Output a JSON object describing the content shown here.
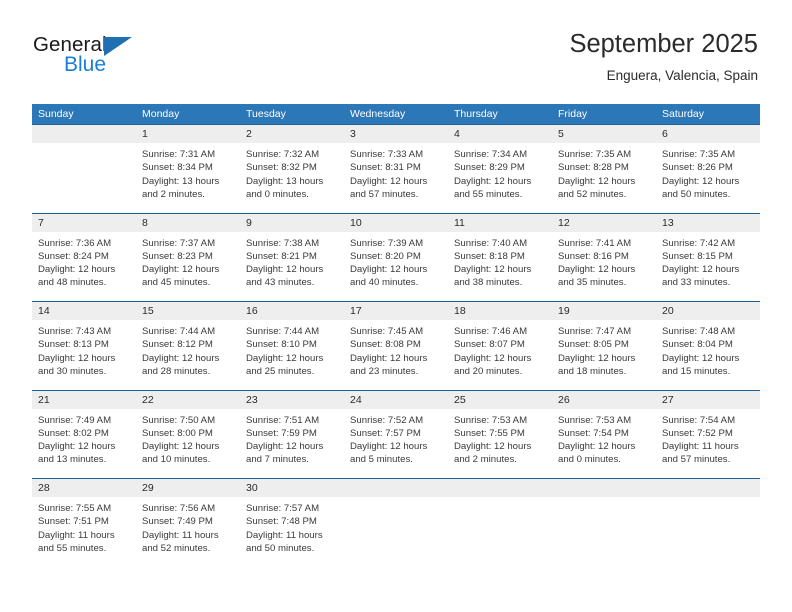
{
  "brand": {
    "name_top": "General",
    "name_bottom": "Blue",
    "accent_color": "#1a7fd4",
    "triangle_color": "#1f6fb2"
  },
  "header": {
    "title": "September 2025",
    "subtitle": "Enguera, Valencia, Spain"
  },
  "calendar": {
    "header_bg": "#2c77b8",
    "header_text_color": "#ffffff",
    "daynum_band_bg": "#eeeeee",
    "week_separator_color": "#1f6099",
    "day_names": [
      "Sunday",
      "Monday",
      "Tuesday",
      "Wednesday",
      "Thursday",
      "Friday",
      "Saturday"
    ],
    "weeks": [
      [
        {
          "day": "",
          "lines": []
        },
        {
          "day": "1",
          "lines": [
            "Sunrise: 7:31 AM",
            "Sunset: 8:34 PM",
            "Daylight: 13 hours",
            "and 2 minutes."
          ]
        },
        {
          "day": "2",
          "lines": [
            "Sunrise: 7:32 AM",
            "Sunset: 8:32 PM",
            "Daylight: 13 hours",
            "and 0 minutes."
          ]
        },
        {
          "day": "3",
          "lines": [
            "Sunrise: 7:33 AM",
            "Sunset: 8:31 PM",
            "Daylight: 12 hours",
            "and 57 minutes."
          ]
        },
        {
          "day": "4",
          "lines": [
            "Sunrise: 7:34 AM",
            "Sunset: 8:29 PM",
            "Daylight: 12 hours",
            "and 55 minutes."
          ]
        },
        {
          "day": "5",
          "lines": [
            "Sunrise: 7:35 AM",
            "Sunset: 8:28 PM",
            "Daylight: 12 hours",
            "and 52 minutes."
          ]
        },
        {
          "day": "6",
          "lines": [
            "Sunrise: 7:35 AM",
            "Sunset: 8:26 PM",
            "Daylight: 12 hours",
            "and 50 minutes."
          ]
        }
      ],
      [
        {
          "day": "7",
          "lines": [
            "Sunrise: 7:36 AM",
            "Sunset: 8:24 PM",
            "Daylight: 12 hours",
            "and 48 minutes."
          ]
        },
        {
          "day": "8",
          "lines": [
            "Sunrise: 7:37 AM",
            "Sunset: 8:23 PM",
            "Daylight: 12 hours",
            "and 45 minutes."
          ]
        },
        {
          "day": "9",
          "lines": [
            "Sunrise: 7:38 AM",
            "Sunset: 8:21 PM",
            "Daylight: 12 hours",
            "and 43 minutes."
          ]
        },
        {
          "day": "10",
          "lines": [
            "Sunrise: 7:39 AM",
            "Sunset: 8:20 PM",
            "Daylight: 12 hours",
            "and 40 minutes."
          ]
        },
        {
          "day": "11",
          "lines": [
            "Sunrise: 7:40 AM",
            "Sunset: 8:18 PM",
            "Daylight: 12 hours",
            "and 38 minutes."
          ]
        },
        {
          "day": "12",
          "lines": [
            "Sunrise: 7:41 AM",
            "Sunset: 8:16 PM",
            "Daylight: 12 hours",
            "and 35 minutes."
          ]
        },
        {
          "day": "13",
          "lines": [
            "Sunrise: 7:42 AM",
            "Sunset: 8:15 PM",
            "Daylight: 12 hours",
            "and 33 minutes."
          ]
        }
      ],
      [
        {
          "day": "14",
          "lines": [
            "Sunrise: 7:43 AM",
            "Sunset: 8:13 PM",
            "Daylight: 12 hours",
            "and 30 minutes."
          ]
        },
        {
          "day": "15",
          "lines": [
            "Sunrise: 7:44 AM",
            "Sunset: 8:12 PM",
            "Daylight: 12 hours",
            "and 28 minutes."
          ]
        },
        {
          "day": "16",
          "lines": [
            "Sunrise: 7:44 AM",
            "Sunset: 8:10 PM",
            "Daylight: 12 hours",
            "and 25 minutes."
          ]
        },
        {
          "day": "17",
          "lines": [
            "Sunrise: 7:45 AM",
            "Sunset: 8:08 PM",
            "Daylight: 12 hours",
            "and 23 minutes."
          ]
        },
        {
          "day": "18",
          "lines": [
            "Sunrise: 7:46 AM",
            "Sunset: 8:07 PM",
            "Daylight: 12 hours",
            "and 20 minutes."
          ]
        },
        {
          "day": "19",
          "lines": [
            "Sunrise: 7:47 AM",
            "Sunset: 8:05 PM",
            "Daylight: 12 hours",
            "and 18 minutes."
          ]
        },
        {
          "day": "20",
          "lines": [
            "Sunrise: 7:48 AM",
            "Sunset: 8:04 PM",
            "Daylight: 12 hours",
            "and 15 minutes."
          ]
        }
      ],
      [
        {
          "day": "21",
          "lines": [
            "Sunrise: 7:49 AM",
            "Sunset: 8:02 PM",
            "Daylight: 12 hours",
            "and 13 minutes."
          ]
        },
        {
          "day": "22",
          "lines": [
            "Sunrise: 7:50 AM",
            "Sunset: 8:00 PM",
            "Daylight: 12 hours",
            "and 10 minutes."
          ]
        },
        {
          "day": "23",
          "lines": [
            "Sunrise: 7:51 AM",
            "Sunset: 7:59 PM",
            "Daylight: 12 hours",
            "and 7 minutes."
          ]
        },
        {
          "day": "24",
          "lines": [
            "Sunrise: 7:52 AM",
            "Sunset: 7:57 PM",
            "Daylight: 12 hours",
            "and 5 minutes."
          ]
        },
        {
          "day": "25",
          "lines": [
            "Sunrise: 7:53 AM",
            "Sunset: 7:55 PM",
            "Daylight: 12 hours",
            "and 2 minutes."
          ]
        },
        {
          "day": "26",
          "lines": [
            "Sunrise: 7:53 AM",
            "Sunset: 7:54 PM",
            "Daylight: 12 hours",
            "and 0 minutes."
          ]
        },
        {
          "day": "27",
          "lines": [
            "Sunrise: 7:54 AM",
            "Sunset: 7:52 PM",
            "Daylight: 11 hours",
            "and 57 minutes."
          ]
        }
      ],
      [
        {
          "day": "28",
          "lines": [
            "Sunrise: 7:55 AM",
            "Sunset: 7:51 PM",
            "Daylight: 11 hours",
            "and 55 minutes."
          ]
        },
        {
          "day": "29",
          "lines": [
            "Sunrise: 7:56 AM",
            "Sunset: 7:49 PM",
            "Daylight: 11 hours",
            "and 52 minutes."
          ]
        },
        {
          "day": "30",
          "lines": [
            "Sunrise: 7:57 AM",
            "Sunset: 7:48 PM",
            "Daylight: 11 hours",
            "and 50 minutes."
          ]
        },
        {
          "day": "",
          "lines": []
        },
        {
          "day": "",
          "lines": []
        },
        {
          "day": "",
          "lines": []
        },
        {
          "day": "",
          "lines": []
        }
      ]
    ]
  }
}
